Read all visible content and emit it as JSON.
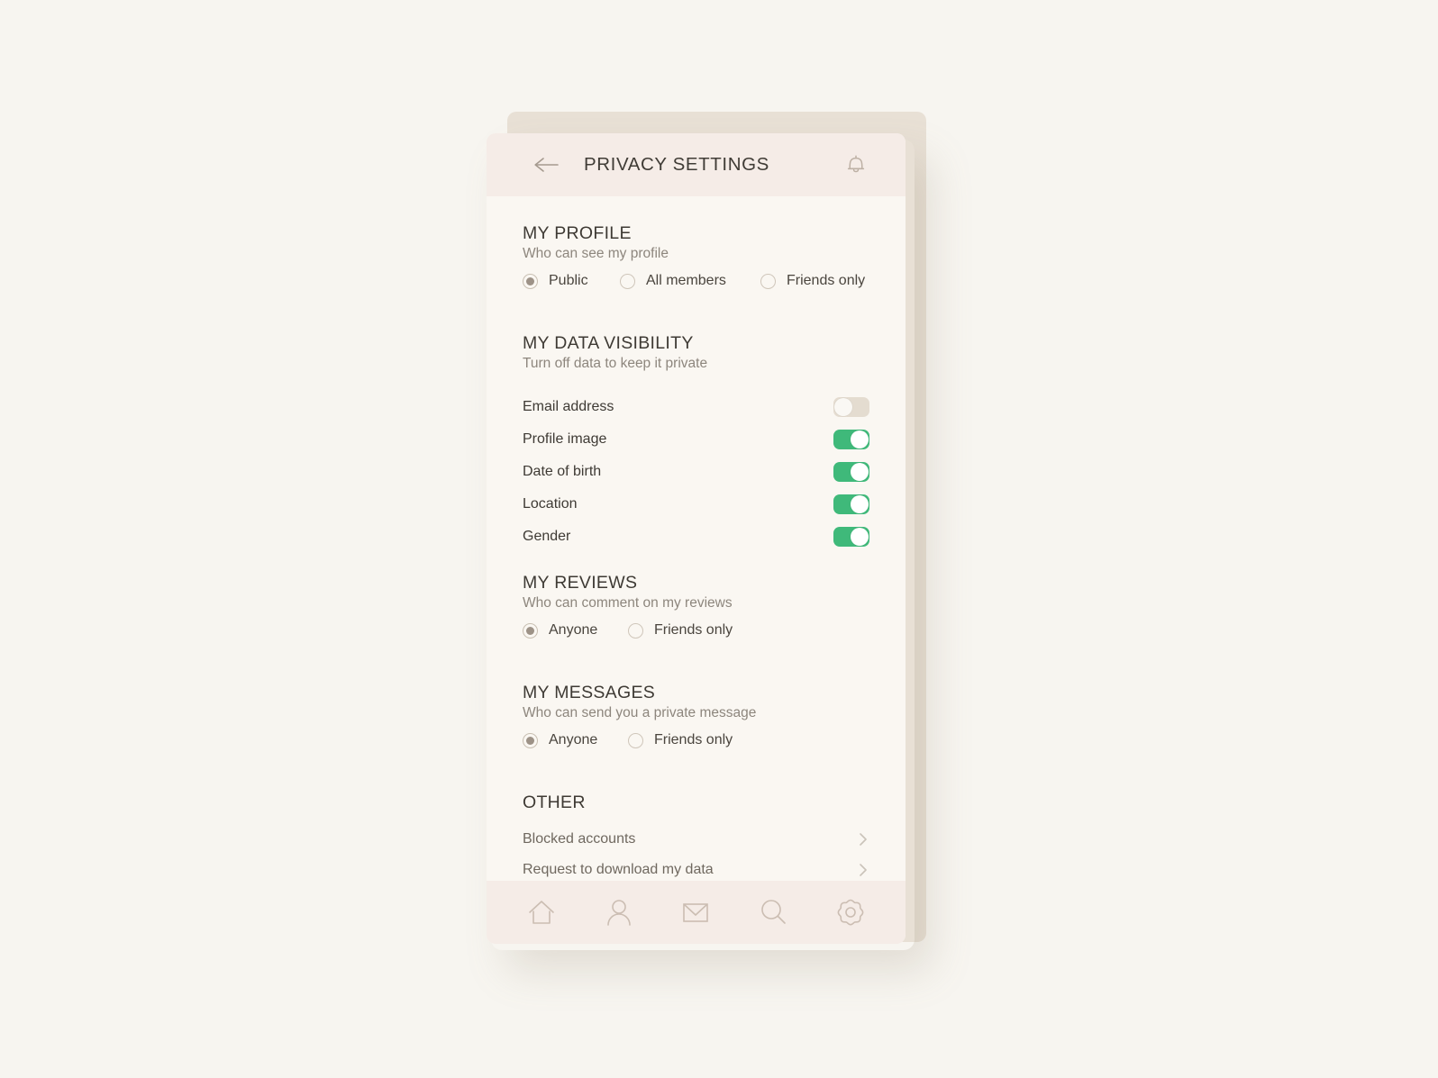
{
  "header": {
    "title": "PRIVACY SETTINGS",
    "back_icon": "back-arrow-icon",
    "notification_icon": "bell-icon",
    "bg_color": "#f5ece7"
  },
  "theme": {
    "page_bg": "#f7f5f0",
    "card_bg": "#faf7f2",
    "backing_card_bg": "#e8e0d5",
    "toggle_on_color": "#3fb97a",
    "toggle_off_color": "#e4dcd0",
    "radio_selected_color": "#9d9287",
    "heading_color": "#3e3a34",
    "subtext_color": "#8d867d"
  },
  "sections": {
    "profile": {
      "title": "MY PROFILE",
      "subtitle": "Who can see my profile",
      "options": [
        {
          "label": "Public",
          "selected": true
        },
        {
          "label": "All members",
          "selected": false
        },
        {
          "label": "Friends only",
          "selected": false
        }
      ]
    },
    "data_visibility": {
      "title": "MY DATA VISIBILITY",
      "subtitle": "Turn off data to keep it private",
      "rows": [
        {
          "label": "Email address",
          "on": false
        },
        {
          "label": "Profile image",
          "on": true
        },
        {
          "label": "Date of birth",
          "on": true
        },
        {
          "label": "Location",
          "on": true
        },
        {
          "label": "Gender",
          "on": true
        }
      ]
    },
    "reviews": {
      "title": "MY REVIEWS",
      "subtitle": "Who can comment on my reviews",
      "options": [
        {
          "label": "Anyone",
          "selected": true
        },
        {
          "label": "Friends only",
          "selected": false
        }
      ]
    },
    "messages": {
      "title": "MY MESSAGES",
      "subtitle": "Who can send you a private message",
      "options": [
        {
          "label": "Anyone",
          "selected": true
        },
        {
          "label": "Friends only",
          "selected": false
        }
      ]
    },
    "other": {
      "title": "OTHER",
      "links": [
        {
          "label": "Blocked accounts",
          "icon": "chevron-right-icon"
        },
        {
          "label": "Request to download my data",
          "icon": "chevron-right-icon"
        }
      ]
    }
  },
  "bottom_nav": {
    "items": [
      {
        "name": "home-icon",
        "label": "Home"
      },
      {
        "name": "profile-icon",
        "label": "Profile"
      },
      {
        "name": "mail-icon",
        "label": "Messages"
      },
      {
        "name": "search-icon",
        "label": "Search"
      },
      {
        "name": "gear-icon",
        "label": "Settings"
      }
    ]
  }
}
